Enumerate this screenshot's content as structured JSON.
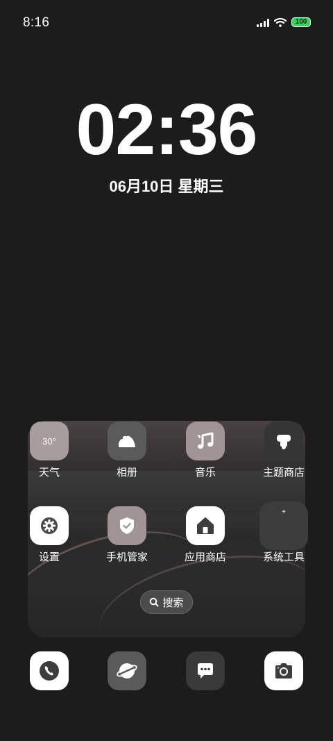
{
  "status_bar": {
    "time": "8:16",
    "battery": "100"
  },
  "clock": {
    "time": "02:36",
    "date": "06月10日 星期三"
  },
  "weather_icon_text": "30°",
  "apps": {
    "weather": "天气",
    "gallery": "相册",
    "music": "音乐",
    "theme_store": "主题商店",
    "settings": "设置",
    "phone_manager": "手机管家",
    "app_store": "应用商店",
    "system_tools": "系统工具"
  },
  "search": {
    "label": "搜索"
  },
  "dock": [
    "phone-icon",
    "browser-icon",
    "messages-icon",
    "camera-icon"
  ],
  "colors": {
    "background": "#1c1c1c",
    "battery": "#3ccf5c",
    "weather_icon_bg": "#a69d9c",
    "music_icon_bg": "#a09594"
  }
}
